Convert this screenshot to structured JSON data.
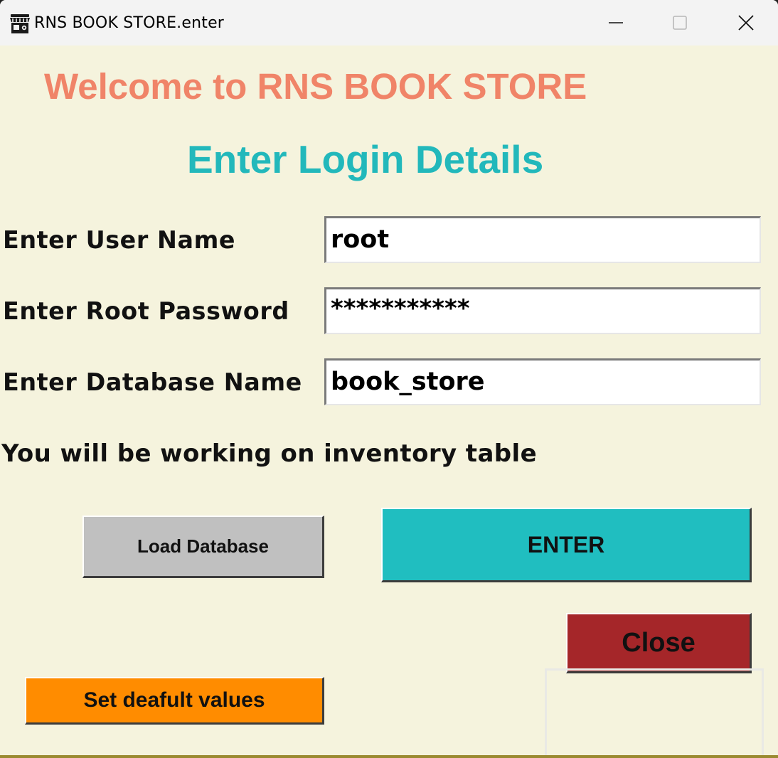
{
  "window": {
    "title": "RNS BOOK STORE.enter",
    "app_icon": "storefront-icon",
    "controls": {
      "minimize": "minimize-icon",
      "maximize": "maximize-icon",
      "close": "close-icon"
    }
  },
  "header": {
    "welcome": "Welcome to RNS BOOK STORE",
    "subtitle": "Enter Login Details"
  },
  "form": {
    "user_label": "Enter User Name",
    "user_value": "root",
    "password_label": "Enter Root Password",
    "password_value": "***********",
    "database_label": "Enter Database Name",
    "database_value": "book_store",
    "info": "You will be working on inventory table"
  },
  "buttons": {
    "load": "Load Database",
    "enter": "ENTER",
    "close": "Close",
    "defaults": "Set deafult values"
  },
  "colors": {
    "background": "#f5f3dd",
    "welcome": "#f08468",
    "subtitle": "#22b8bb",
    "enter_button": "#20bec0",
    "close_button": "#a52629",
    "defaults_button": "#ff8c00",
    "load_button": "#c0c0c0"
  }
}
